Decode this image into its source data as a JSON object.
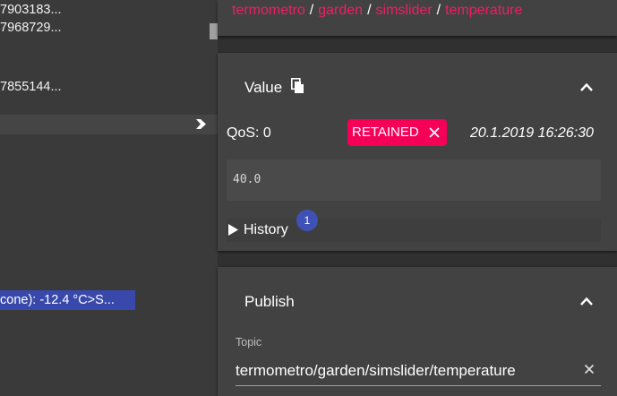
{
  "tree": {
    "lines": [
      "7903183...",
      "7968729...",
      "7855144..."
    ],
    "highlighted_item": "cone): -12.4 °C>S..."
  },
  "breadcrumb": {
    "parts": [
      "termometro",
      "garden",
      "simslider",
      "temperature"
    ],
    "separator": "/"
  },
  "value_panel": {
    "title": "Value",
    "qos_text": "QoS: 0",
    "retained_label": "RETAINED",
    "timestamp": "20.1.2019 16:26:30",
    "payload": "40.0",
    "history_label": "History",
    "history_count": "1"
  },
  "publish_panel": {
    "title": "Publish",
    "topic_label": "Topic",
    "topic_value": "termometro/garden/simslider/temperature"
  },
  "colors": {
    "accent": "#ef1f63",
    "chip": "#f50057",
    "badge": "#3f51b5",
    "selection": "#3949ab"
  },
  "icons": {
    "copy": "copy-icon",
    "expand": "chevron-up-icon",
    "history_toggle": "play-triangle-icon",
    "chip_remove": "close-icon",
    "clear": "close-icon",
    "tree_expand": "chevron-right-icon"
  }
}
